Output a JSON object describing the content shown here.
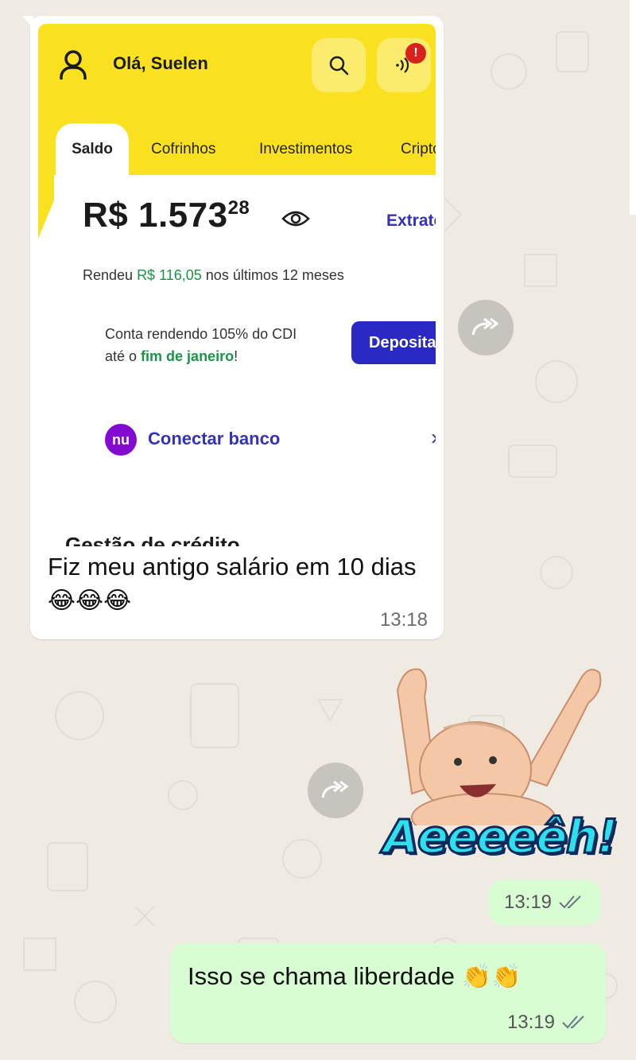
{
  "colors": {
    "app_yellow": "#f9e11f",
    "nubank_purple": "#820ad1",
    "accent_blue": "#3432b8",
    "green": "#1b9446",
    "outgoing_bubble": "#d9fdd3"
  },
  "screenshot": {
    "greeting": "Olá, Suelen",
    "notification_badge": "!",
    "tabs": [
      "Saldo",
      "Cofrinhos",
      "Investimentos",
      "Cripto"
    ],
    "balance_main": "R$ 1.573",
    "balance_cents": "28",
    "extrato": "Extrato",
    "rendeu_prefix": "Rendeu ",
    "rendeu_amount": "R$ 116,05",
    "rendeu_suffix": " nos últimos 12 meses",
    "cdi_line1": "Conta rendendo 105% do CDI",
    "cdi_line2_prefix": "até o ",
    "cdi_line2_highlight": "fim de janeiro",
    "cdi_line2_suffix": "!",
    "depositar": "Depositar",
    "nu_logo": "nu",
    "conectar_banco": "Conectar banco",
    "chevron": "›",
    "cut_off_text": "Gestão de crédito"
  },
  "messages": {
    "incoming_text": "Fiz meu antigo salário em 10 dias",
    "incoming_emojis": "😂😂😂",
    "incoming_time": "13:18",
    "sticker_text": "Aeeeeêh!",
    "sticker_time": "13:19",
    "outgoing_text": "Isso se chama liberdade",
    "outgoing_emojis": "👏👏",
    "outgoing_time": "13:19"
  }
}
